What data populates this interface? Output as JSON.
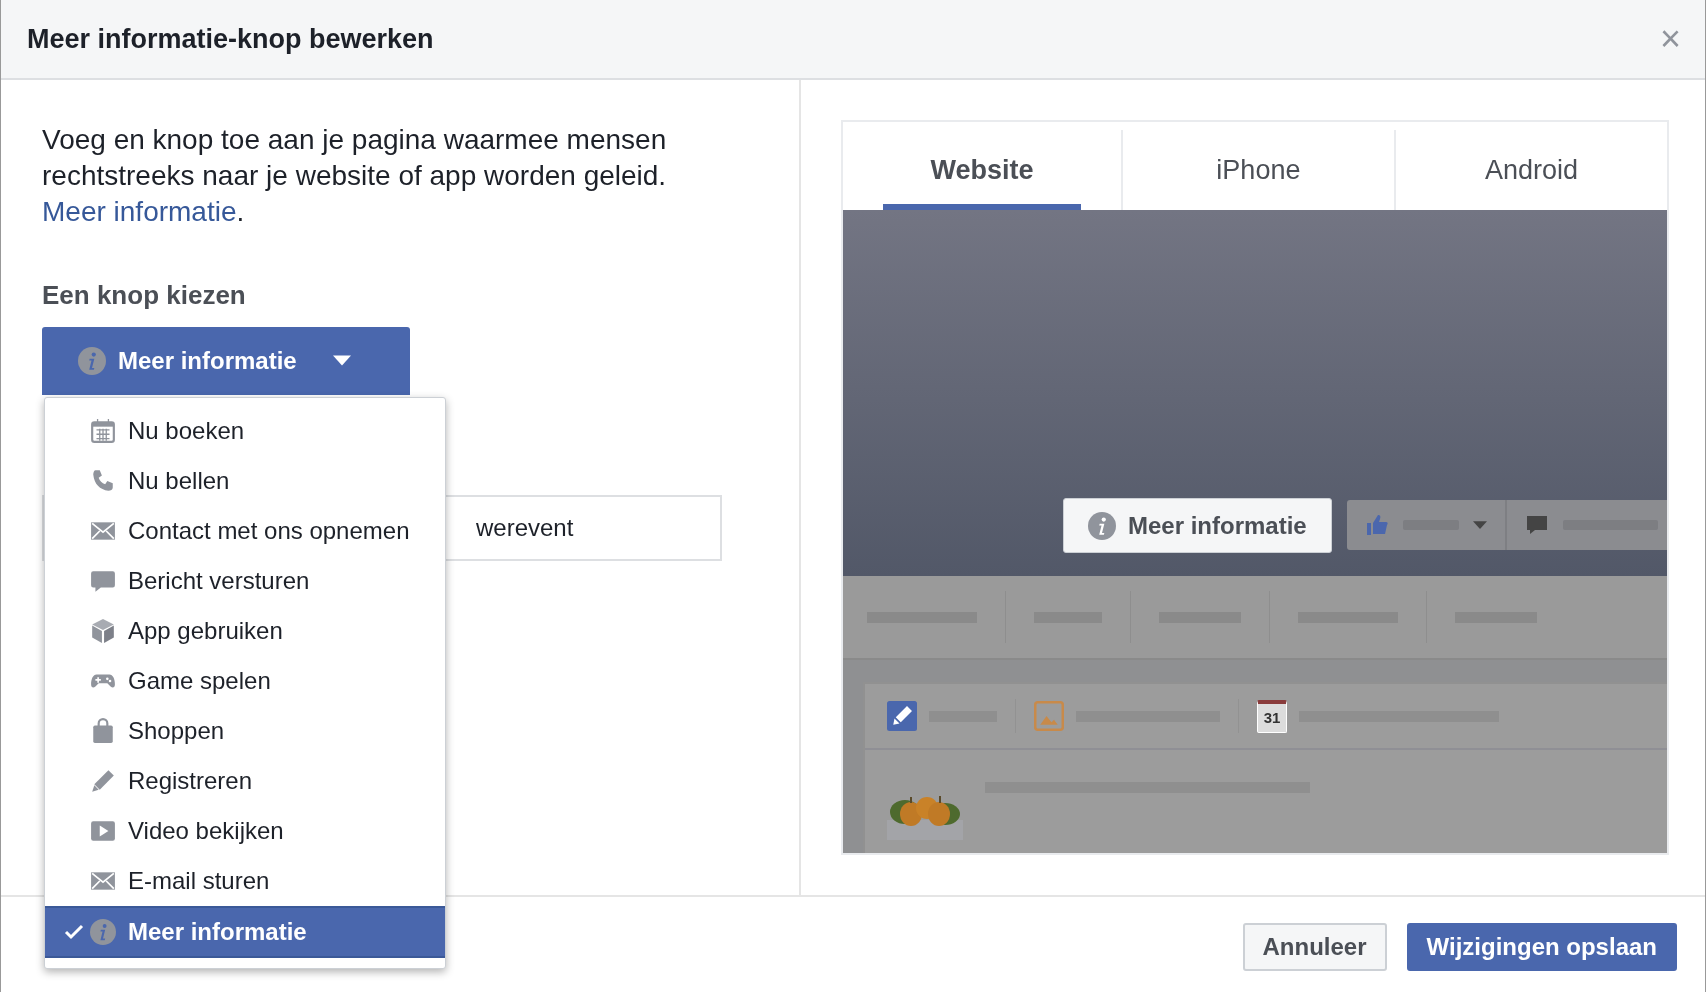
{
  "dialog": {
    "title": "Meer informatie-knop bewerken",
    "close": "×"
  },
  "intro": {
    "text": "Voeg en knop toe aan je pagina waarmee mensen rechtstreeks naar je website of app worden geleid.",
    "link": "Meer informatie",
    "after": "."
  },
  "section_label": "Een knop kiezen",
  "button_select": {
    "label": "Meer informatie",
    "expanded": true
  },
  "menu": [
    {
      "label": "Nu boeken",
      "kind": "calendar",
      "selected": false
    },
    {
      "label": "Nu bellen",
      "kind": "phone",
      "selected": false
    },
    {
      "label": "Contact met ons opnemen",
      "kind": "mail",
      "selected": false
    },
    {
      "label": "Bericht versturen",
      "kind": "chat",
      "selected": false
    },
    {
      "label": "App gebruiken",
      "kind": "cube",
      "selected": false
    },
    {
      "label": "Game spelen",
      "kind": "gamepad",
      "selected": false
    },
    {
      "label": "Shoppen",
      "kind": "bag",
      "selected": false
    },
    {
      "label": "Registreren",
      "kind": "pencil",
      "selected": false
    },
    {
      "label": "Video bekijken",
      "kind": "video",
      "selected": false
    },
    {
      "label": "E-mail sturen",
      "kind": "mail",
      "selected": false
    },
    {
      "label": "Meer informatie",
      "kind": "info",
      "selected": true
    }
  ],
  "field": {
    "value": "werevent"
  },
  "preview": {
    "tabs": [
      {
        "label": "Website",
        "selected": true
      },
      {
        "label": "iPhone",
        "selected": false
      },
      {
        "label": "Android",
        "selected": false
      }
    ],
    "cta": "Meer informatie",
    "calendar_day": "31"
  },
  "footer": {
    "buttons": [
      {
        "label": "Annuleer",
        "kind": "secondary"
      },
      {
        "label": "Wijzigingen opslaan",
        "kind": "primary"
      }
    ]
  }
}
